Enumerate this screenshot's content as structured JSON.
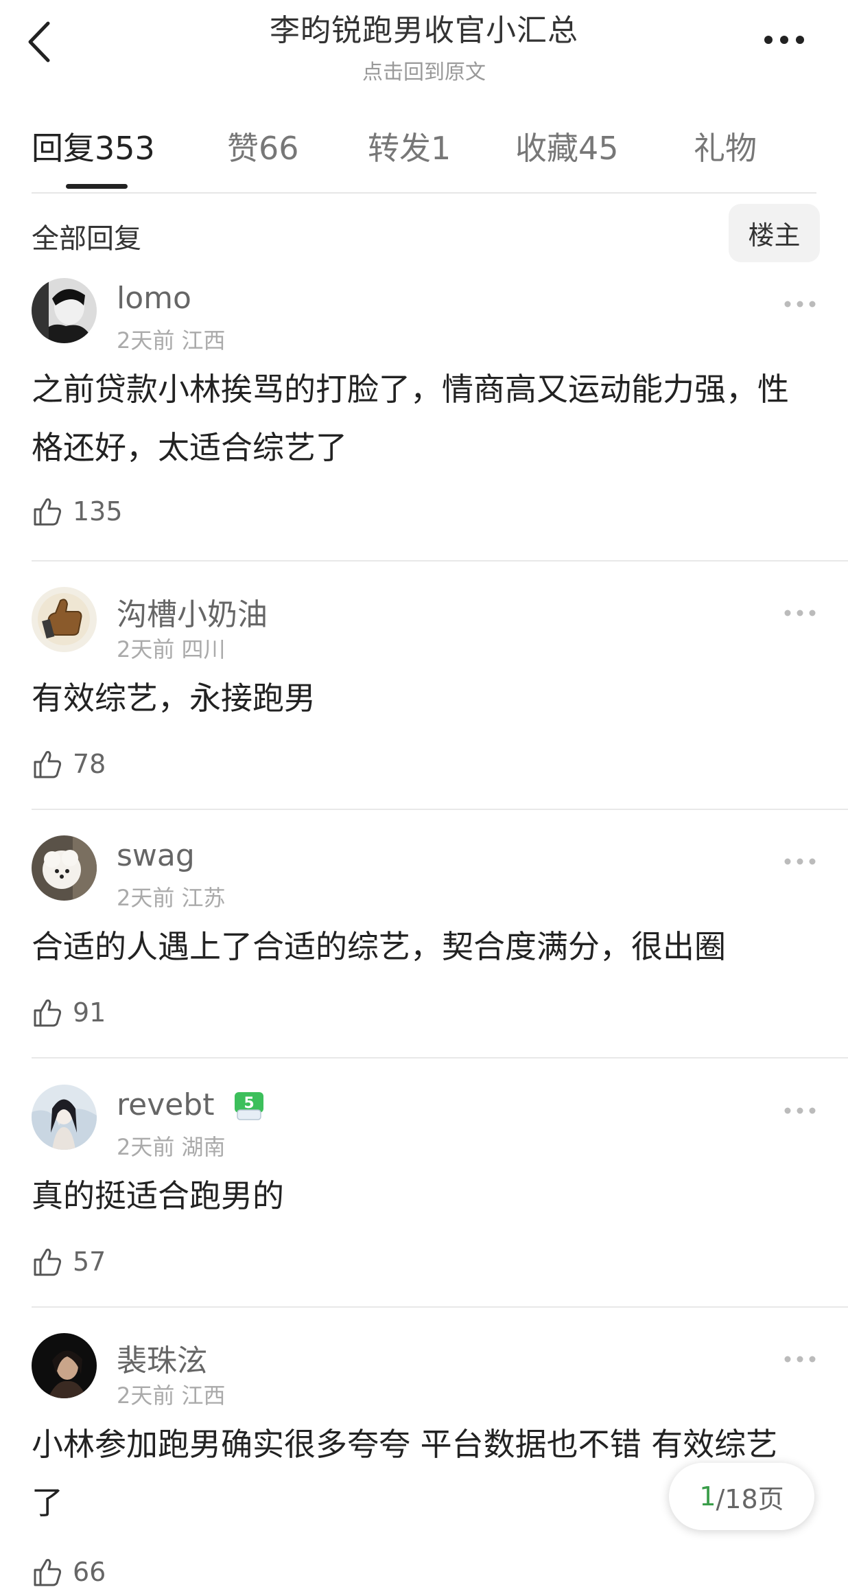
{
  "header": {
    "title": "李昀锐跑男收官小汇总",
    "subtitle": "点击回到原文"
  },
  "tabs": [
    {
      "label": "回复",
      "count": "353",
      "active": true
    },
    {
      "label": "赞",
      "count": "66",
      "active": false
    },
    {
      "label": "转发",
      "count": "1",
      "active": false
    },
    {
      "label": "收藏",
      "count": "45",
      "active": false
    },
    {
      "label": "礼物",
      "count": "",
      "active": false
    }
  ],
  "filter": {
    "label": "全部回复",
    "op_button": "楼主"
  },
  "comments": [
    {
      "username": "lomo",
      "time": "2天前",
      "location": "江西",
      "text": "之前贷款小林挨骂的打脸了，情商高又运动能力强，性格还好，太适合综艺了",
      "likes": "135",
      "avatar_icon": "user-avatar-bw-portrait"
    },
    {
      "username": "沟槽小奶油",
      "time": "2天前",
      "location": "四川",
      "text": "有效综艺，永接跑男",
      "likes": "78",
      "avatar_icon": "thumbs-up-hand-avatar"
    },
    {
      "username": "swag",
      "time": "2天前",
      "location": "江苏",
      "text": "合适的人遇上了合适的综艺，契合度满分，很出圈",
      "likes": "91",
      "avatar_icon": "white-dog-avatar"
    },
    {
      "username": "revebt",
      "time": "2天前",
      "location": "湖南",
      "text": "真的挺适合跑男的",
      "likes": "57",
      "avatar_icon": "woman-portrait-avatar",
      "level_badge": "5"
    },
    {
      "username": "裴珠泫",
      "time": "2天前",
      "location": "江西",
      "text": "小林参加跑男确实很多夸夸 平台数据也不错 有效综艺了",
      "likes": "66",
      "avatar_icon": "dark-portrait-avatar"
    }
  ],
  "pager": {
    "current": "1",
    "total": "/18页"
  },
  "colors": {
    "accent_green": "#3a9d4a",
    "text_primary": "#222222",
    "text_secondary": "#999999"
  }
}
